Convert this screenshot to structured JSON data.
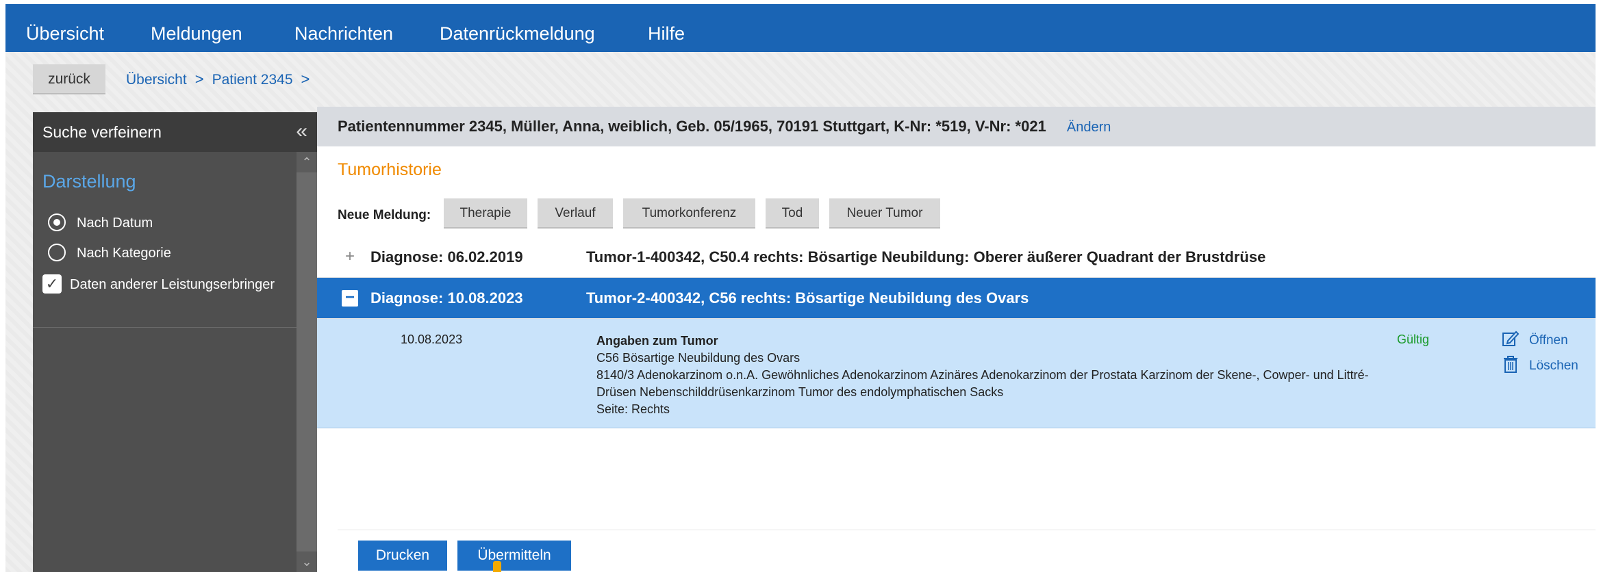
{
  "nav": [
    "Übersicht",
    "Meldungen",
    "Nachrichten",
    "Datenrückmeldung",
    "Hilfe"
  ],
  "back_label": "zurück",
  "breadcrumb": [
    "Übersicht",
    "Patient 2345"
  ],
  "sidebar": {
    "title": "Suche verfeinern",
    "section": "Darstellung",
    "options": [
      "Nach Datum",
      "Nach Kategorie"
    ],
    "selected_option": "Nach Datum",
    "checkbox_label": "Daten anderer Leistungserbringer",
    "checkbox_checked": true
  },
  "patient": {
    "info": "Patientennummer 2345, Müller, Anna, weiblich, Geb. 05/1965, 70191 Stuttgart, K-Nr: *519, V-Nr: *021",
    "change": "Ändern"
  },
  "history": {
    "title": "Tumorhistorie",
    "new_label": "Neue Meldung:",
    "buttons": [
      "Therapie",
      "Verlauf",
      "Tumorkonferenz",
      "Tod",
      "Neuer Tumor"
    ],
    "diagnoses": [
      {
        "date": "Diagnose: 06.02.2019",
        "desc": "Tumor-1-400342, C50.4 rechts: Bösartige Neubildung: Oberer äußerer Quadrant der Brustdrüse",
        "expanded": false,
        "toggle": "+"
      },
      {
        "date": "Diagnose: 10.08.2023",
        "desc": "Tumor-2-400342, C56 rechts: Bösartige Neubildung des Ovars",
        "expanded": true,
        "toggle": "−"
      }
    ],
    "detail": {
      "date": "10.08.2023",
      "title": "Angaben zum Tumor",
      "lines": [
        "C56 Bösartige Neubildung des Ovars",
        "8140/3 Adenokarzinom o.n.A. Gewöhnliches Adenokarzinom Azinäres Adenokarzinom der Prostata Karzinom der Skene-, Cowper- und Littré-Drüsen Nebenschilddrüsenkarzinom Tumor des endolymphatischen Sacks",
        "Seite: Rechts"
      ],
      "status": "Gültig",
      "open": "Öffnen",
      "delete": "Löschen"
    }
  },
  "footer": {
    "print": "Drucken",
    "send": "Übermitteln"
  },
  "colors": {
    "nav": "#1a64b4",
    "accent_orange": "#f08a00",
    "expanded": "#1e70c6",
    "detail_bg": "#c9e3fa",
    "valid": "#1a9a2a"
  }
}
